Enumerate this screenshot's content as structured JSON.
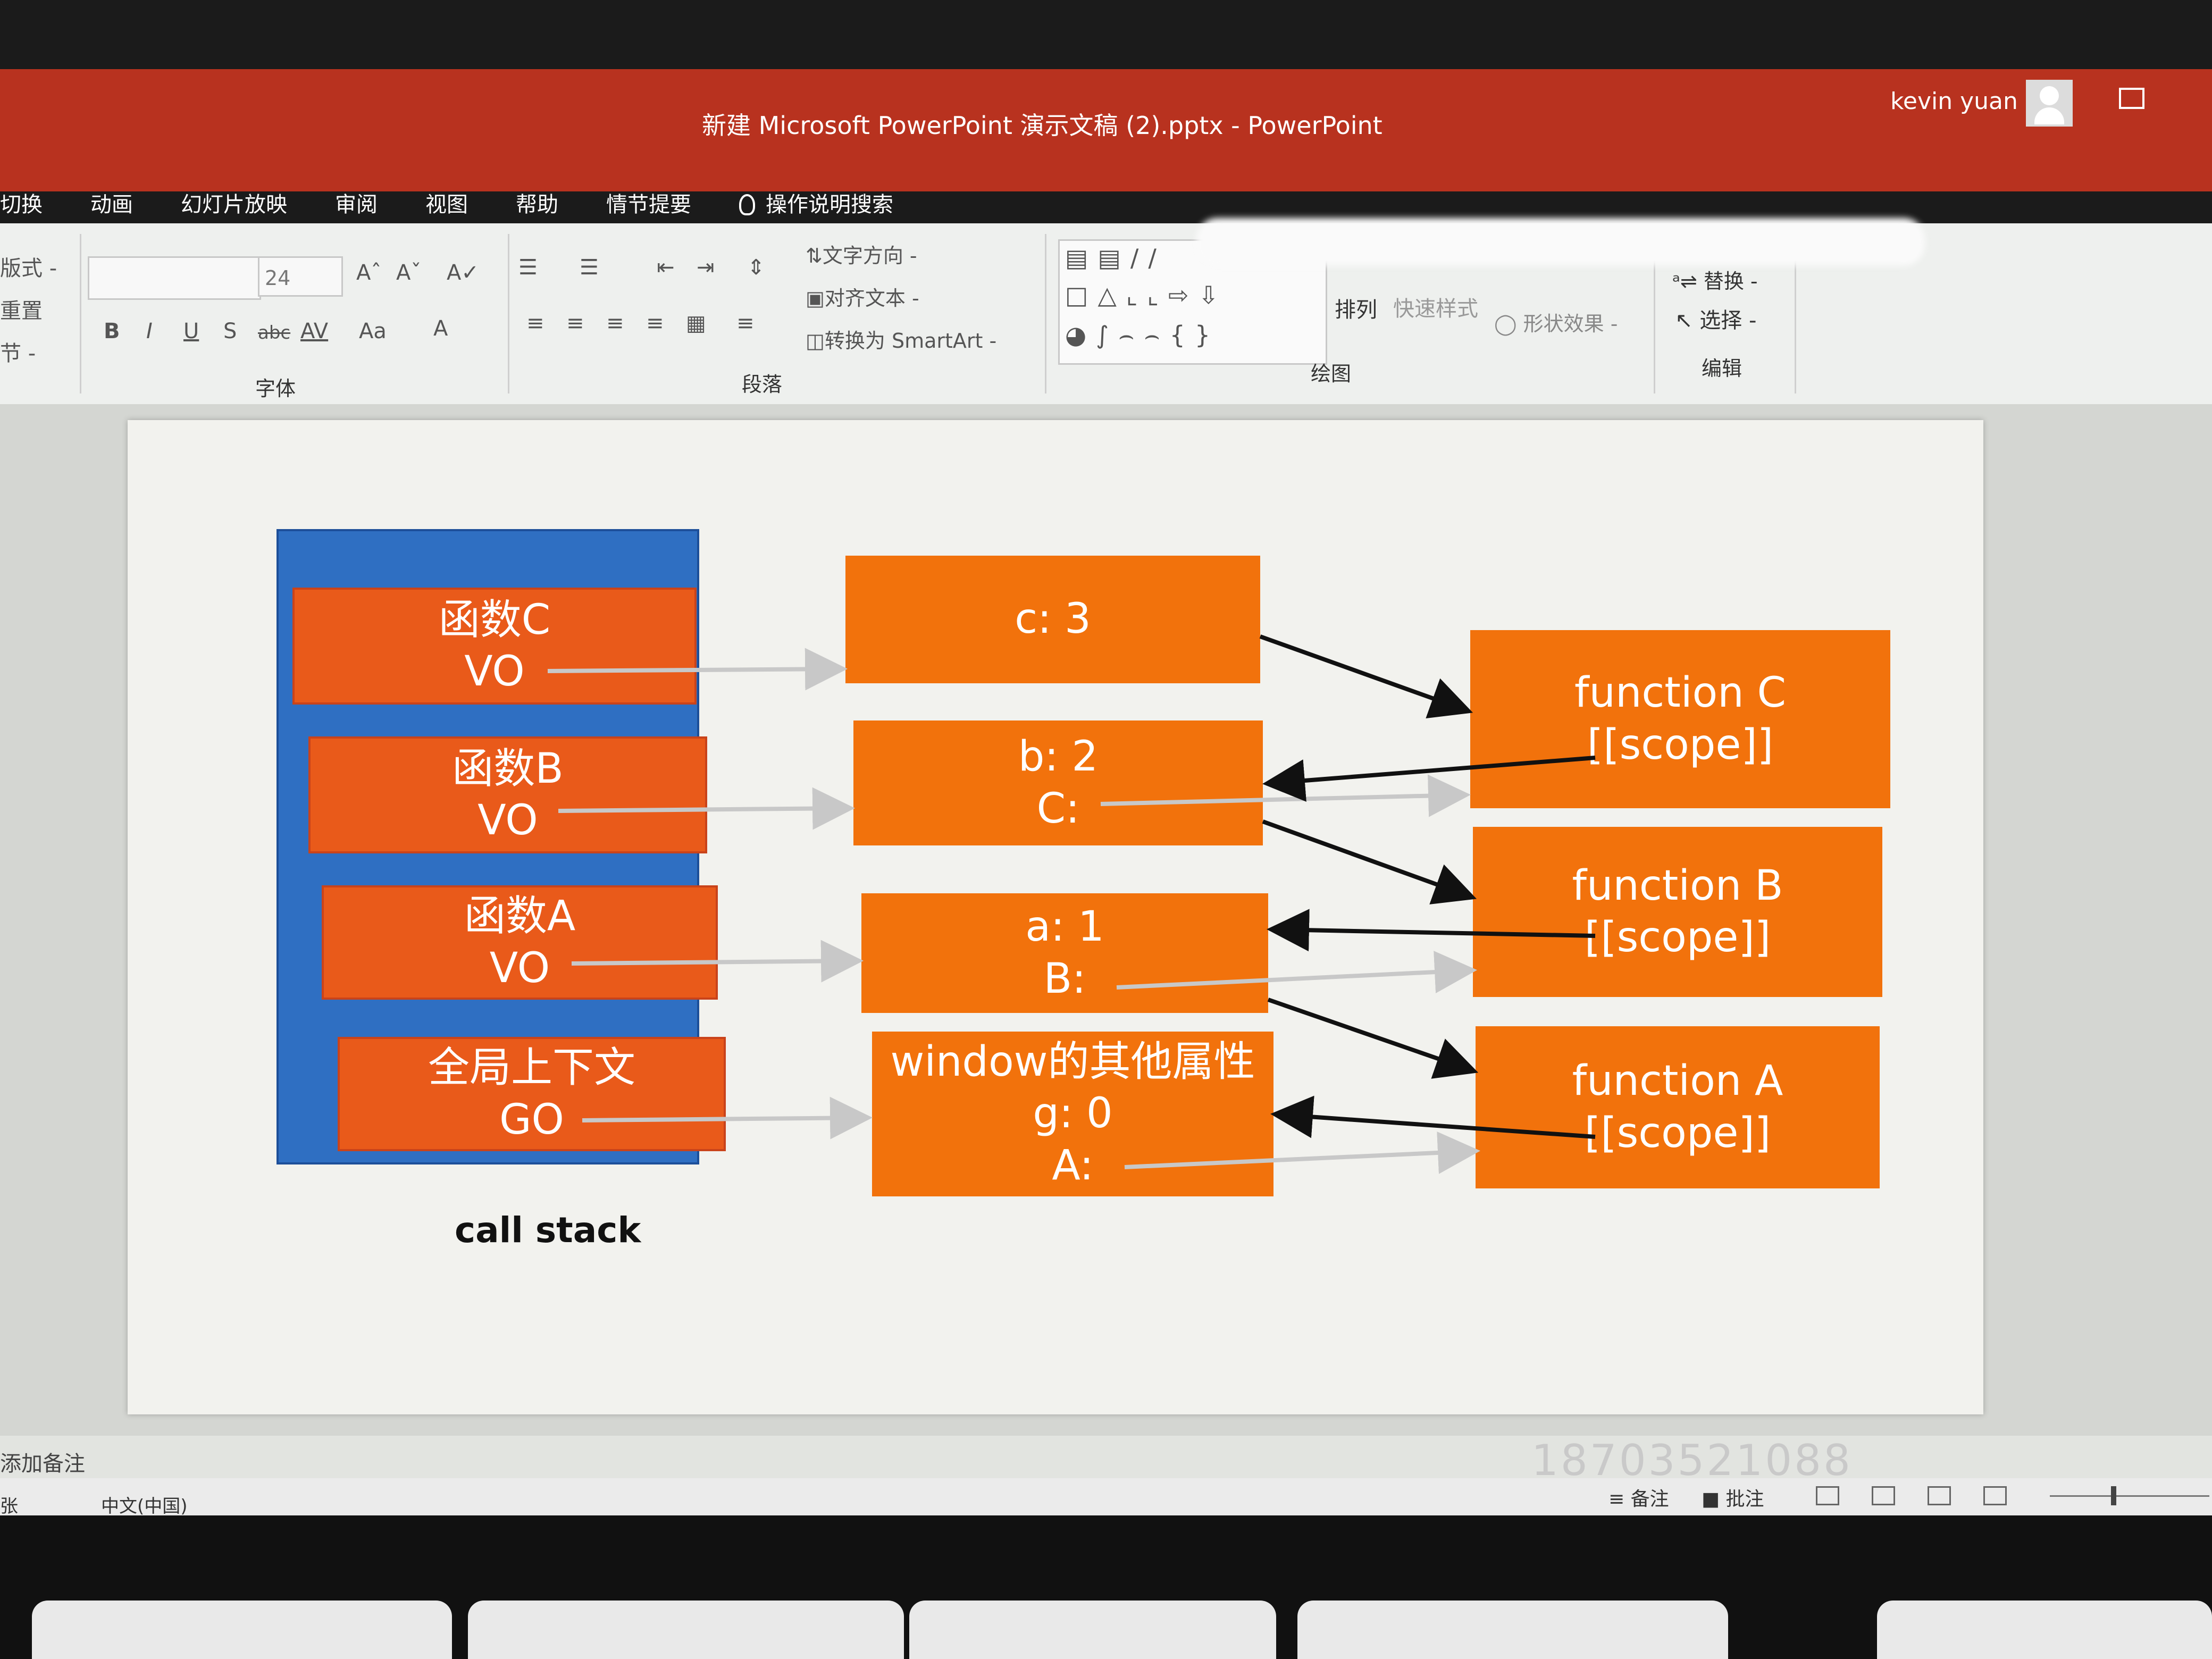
{
  "window": {
    "title": "新建 Microsoft PowerPoint 演示文稿 (2).pptx  -  PowerPoint",
    "user": "kevin yuan"
  },
  "tabs": [
    "切换",
    "动画",
    "幻灯片放映",
    "审阅",
    "视图",
    "帮助",
    "情节提要",
    "操作说明搜索"
  ],
  "ribbon": {
    "layout_items": [
      "版式 -",
      "重置",
      "节 -"
    ],
    "font_size": "24",
    "font_buttons": [
      "B",
      "I",
      "U",
      "S",
      "abc",
      "AV",
      "Aa",
      "A"
    ],
    "groups": {
      "font": "字体",
      "paragraph": "段落",
      "drawing": "绘图",
      "editing": "编辑"
    },
    "paragraph_buttons": [
      "文字方向 -",
      "对齐文本 -",
      "转换为 SmartArt -"
    ],
    "drawing_buttons": [
      "排列",
      "快速样式",
      "形状效果 -"
    ],
    "editing_buttons": [
      "替换 -",
      "选择 -"
    ]
  },
  "slide": {
    "stack_frames": [
      {
        "name": "函数C",
        "label": "VO"
      },
      {
        "name": "函数B",
        "label": "VO"
      },
      {
        "name": "函数A",
        "label": "VO"
      },
      {
        "name": "全局上下文",
        "label": "GO"
      }
    ],
    "variable_objects": [
      {
        "lines": [
          "c: 3"
        ]
      },
      {
        "lines": [
          "b: 2",
          "C:"
        ]
      },
      {
        "lines": [
          "a: 1",
          "B:"
        ]
      },
      {
        "lines": [
          "window的其他属性",
          "g: 0",
          "A:"
        ]
      }
    ],
    "functions": [
      {
        "name": "function C",
        "scope": "[[scope]]"
      },
      {
        "name": "function B",
        "scope": "[[scope]]"
      },
      {
        "name": "function A",
        "scope": "[[scope]]"
      }
    ],
    "caption": "call stack"
  },
  "notes": {
    "placeholder": "添加备注",
    "watermark": "18703521088"
  },
  "statusbar": {
    "slide_info": "张",
    "language": "中文(中国)",
    "notes_button": "备注",
    "comments_button": "批注"
  }
}
